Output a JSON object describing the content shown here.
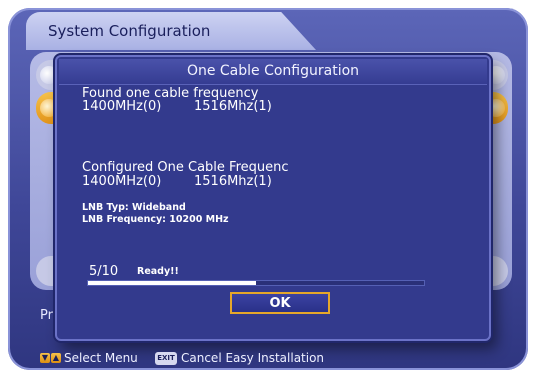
{
  "header": {
    "title": "System Configuration"
  },
  "background": {
    "side_label": "Pr"
  },
  "dialog": {
    "title": "One Cable Configuration",
    "found_label": "Found one cable frequency",
    "found_freq_1": "1400MHz(0)",
    "found_freq_2": "1516Mhz(1)",
    "configured_label": "Configured One Cable Frequenc",
    "configured_freq_1": "1400MHz(0)",
    "configured_freq_2": "1516Mhz(1)",
    "lnb_type": "LNB Typ: Wideband",
    "lnb_frequency": "LNB Frequency: 10200 MHz",
    "progress_label": "5/10",
    "status": "Ready!!",
    "progress_fraction": 0.5,
    "ok_label": "OK"
  },
  "footer": {
    "select_menu_label": "Select Menu",
    "exit_key_label": "EXIT",
    "cancel_label": "Cancel Easy Installation"
  },
  "colors": {
    "background_blue": "#3f4798",
    "accent_orange": "#e2941a",
    "dialog_blue": "#333a8d",
    "text_white": "#ffffff"
  }
}
